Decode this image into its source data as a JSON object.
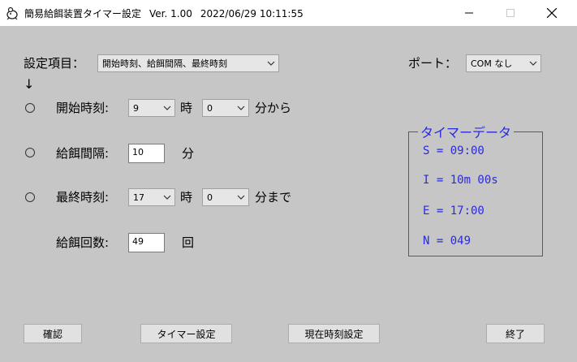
{
  "window": {
    "title": "簡易給餌装置タイマー設定",
    "version": "Ver. 1.00",
    "datetime": "2022/06/29  10:11:55"
  },
  "settings": {
    "label": "設定項目：",
    "selected": "開始時刻、給餌間隔、最終時刻",
    "arrow": "↓"
  },
  "port": {
    "label": "ポート：",
    "selected": "COM なし"
  },
  "start": {
    "label": "開始時刻:",
    "hour": "9",
    "hour_unit": "時",
    "minute": "0",
    "suffix": "分から"
  },
  "interval": {
    "label": "給餌間隔:",
    "value": "10",
    "unit": "分"
  },
  "end": {
    "label": "最終時刻:",
    "hour": "17",
    "hour_unit": "時",
    "minute": "0",
    "suffix": "分まで"
  },
  "count": {
    "label": "給餌回数:",
    "value": "49",
    "unit": "回"
  },
  "timer_data": {
    "title": "タイマーデータ",
    "lines": [
      "S = 09:00",
      "I = 10m 00s",
      "E = 17:00",
      "N = 049"
    ]
  },
  "buttons": {
    "confirm": "確認",
    "timer_set": "タイマー設定",
    "current_time_set": "現在時刻設定",
    "exit": "終了"
  },
  "colors": {
    "background": "#c6c6c6",
    "timer_text": "#2a2ae0"
  }
}
